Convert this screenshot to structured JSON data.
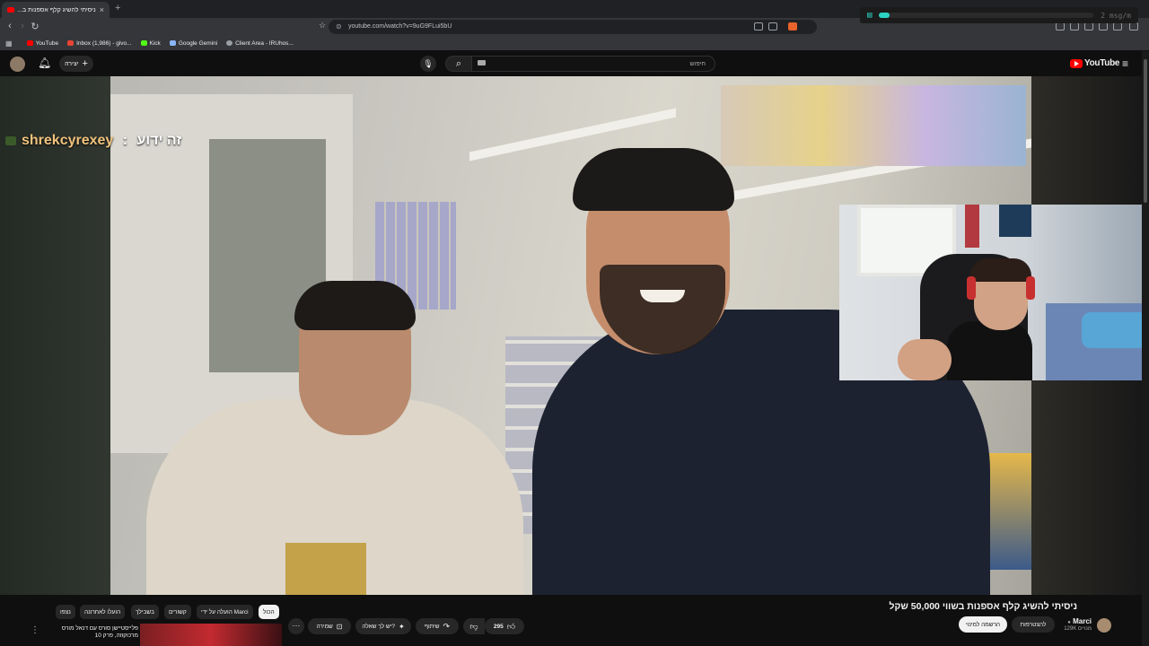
{
  "browser": {
    "tab_title": "ניסיתי להשיג קלף אספנות ב...",
    "tab_close": "×",
    "new_tab": "+",
    "url": "youtube.com/watch?v=9uG9FLui5bU",
    "bookmarks": [
      {
        "label": "YouTube",
        "color": "#ff0000"
      },
      {
        "label": "Inbox (1,986) - givo...",
        "color": "#ea4335"
      },
      {
        "label": "Kick",
        "color": "#53fc18"
      },
      {
        "label": "Google Gemini",
        "color": "#8ab4f8"
      },
      {
        "label": "Client Area - IRUhos...",
        "color": "#9aa0a6"
      }
    ]
  },
  "chat_widget": {
    "rate": "2 msg/m",
    "fill": 0.05,
    "accent": "#2ad3c3"
  },
  "youtube": {
    "logo": "YouTube",
    "search_placeholder": "חיפוש",
    "create_label": "יצירה",
    "accent": "#ff0000"
  },
  "overlay": {
    "username": "shrekcyrexey",
    "separator": " : ",
    "message": "זה ידוע"
  },
  "video": {
    "title": "ניסיתי להשיג קלף אספנות בשווי 50,000 שקל",
    "channel": "Marci",
    "subscribers": "129K מנויים",
    "join_label": "להצטרפות",
    "subscribe_label": "הרשמה למינוי",
    "likes": "295",
    "share_label": "שיתוף",
    "ask_label": "יש לך שאלה?",
    "save_label": "שמירה",
    "more_label": "···"
  },
  "chips": [
    "הכול",
    "הועלה על ידי Marci",
    "קשורים",
    "בשבילך",
    "הועלו לאחרונה",
    "נצפו"
  ],
  "recommendation": {
    "title": "פלייסטיישן סורס עם דנאל מורס מרכוקוזה, פרק 10"
  }
}
